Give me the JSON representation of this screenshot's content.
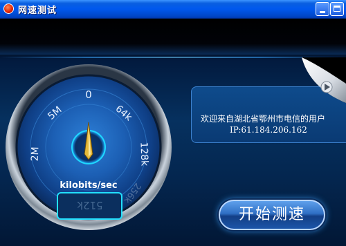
{
  "window": {
    "title": "网速测试"
  },
  "gauge": {
    "tick_labels": [
      "0",
      "5M",
      "64k",
      "2M",
      "128k"
    ],
    "faded_label": "256k",
    "unit_label": "kilobits/sec",
    "readout": "512k",
    "needle_value": "0"
  },
  "info": {
    "welcome": "欢迎来自湖北省鄂州市电信的用户",
    "ip": "IP:61.184.206.162"
  },
  "actions": {
    "start_label": "开始测速"
  },
  "colors": {
    "titlebar": "#0058ee",
    "accent_cyan": "#1fd8ff",
    "needle": "#e6b93a",
    "button": "#2f6fc4"
  }
}
